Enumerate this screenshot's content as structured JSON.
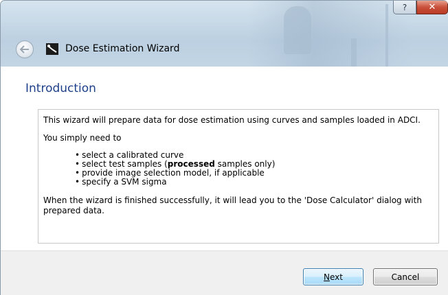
{
  "window": {
    "title": "Dose Estimation Wizard",
    "help_glyph": "?",
    "close_glyph": "✕"
  },
  "page": {
    "heading": "Introduction",
    "intro_text": "This wizard will prepare data for dose estimation using curves and samples loaded in ADCI.",
    "lead_text": "You simply need to",
    "bullets": [
      {
        "before": "select a calibrated curve",
        "bold": "",
        "after": ""
      },
      {
        "before": "select test samples (",
        "bold": "processed",
        "after": " samples only)"
      },
      {
        "before": "provide image selection model, if applicable",
        "bold": "",
        "after": ""
      },
      {
        "before": "specify a SVM sigma",
        "bold": "",
        "after": ""
      }
    ],
    "closing_text": "When the wizard is finished successfully, it will lead you to the 'Dose Calculator' dialog with prepared data."
  },
  "buttons": {
    "next_label": "Next",
    "cancel_label": "Cancel"
  },
  "colors": {
    "heading": "#1e3f8a",
    "close_button": "#c9503a",
    "next_button_border": "#3c7fb1"
  }
}
